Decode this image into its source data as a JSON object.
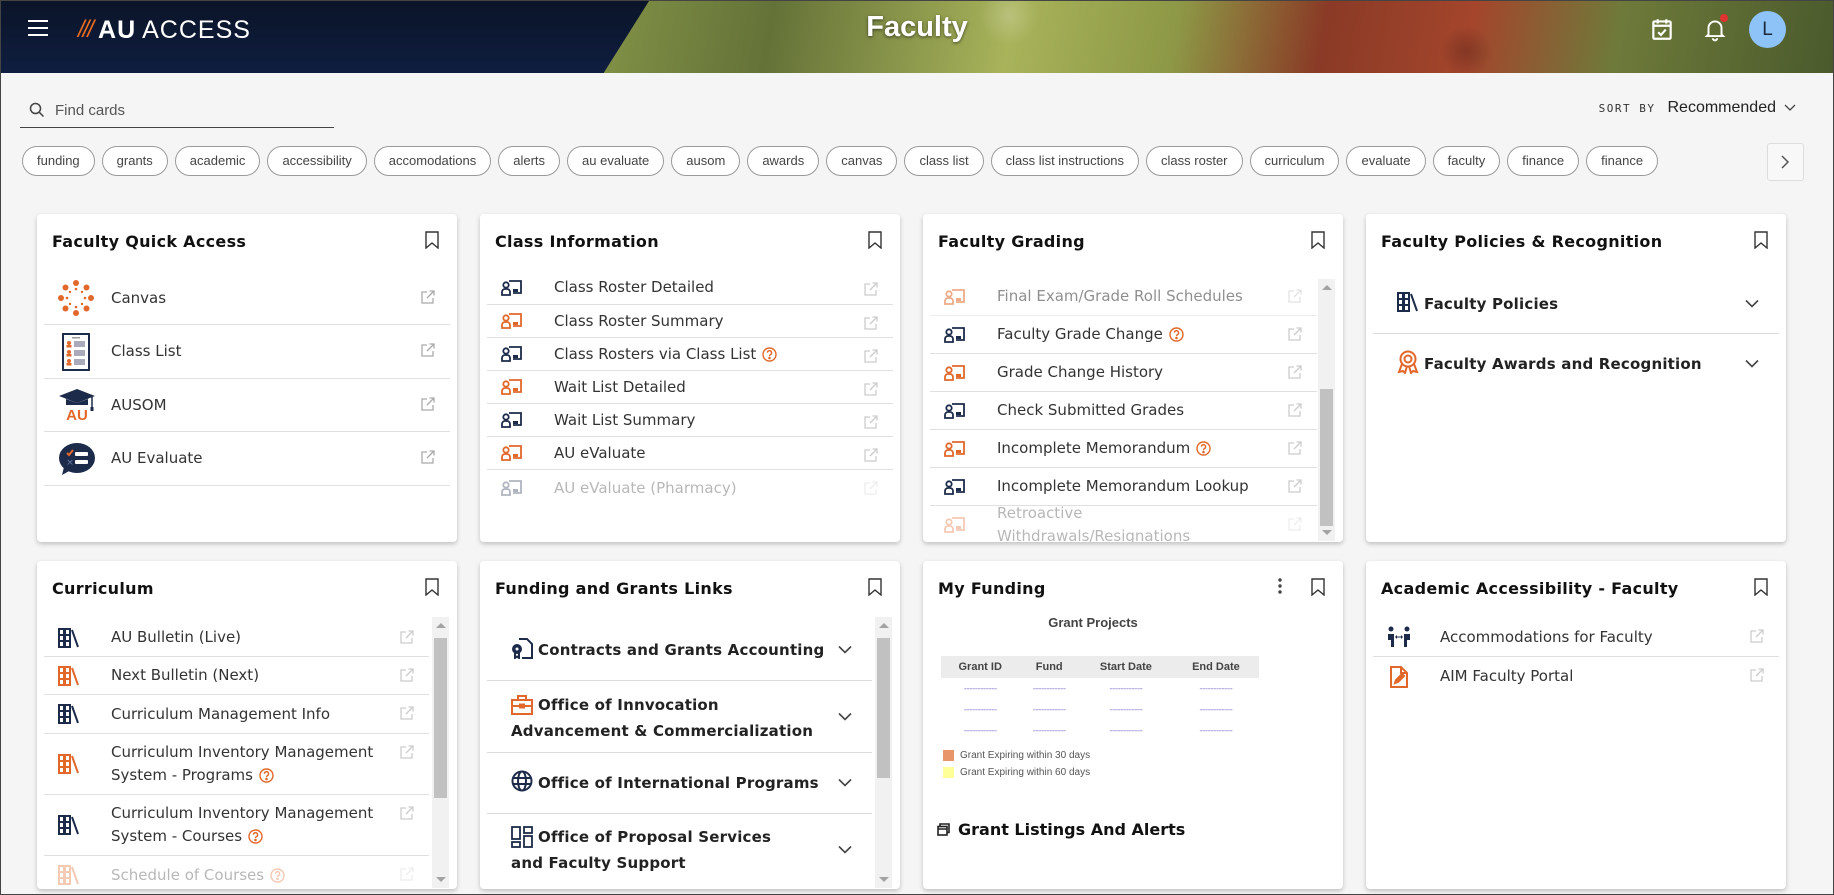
{
  "header": {
    "logo_slashes": "///",
    "logo_au": "AU",
    "logo_access": "ACCESS",
    "page_title": "Faculty",
    "avatar_initial": "L",
    "colors": {
      "navy": "#0f1e40",
      "orange": "#e86b1f",
      "avatar": "#8ec3f7",
      "notification_dot": "#e0322f"
    }
  },
  "search": {
    "placeholder": "Find cards",
    "value": ""
  },
  "sort": {
    "label": "SORT BY",
    "value": "Recommended"
  },
  "chips": [
    "funding",
    "grants",
    "academic",
    "accessibility",
    "accomodations",
    "alerts",
    "au evaluate",
    "ausom",
    "awards",
    "canvas",
    "class list",
    "class list instructions",
    "class roster",
    "curriculum",
    "evaluate",
    "faculty",
    "finance",
    "finance"
  ],
  "cards": {
    "quick_access": {
      "title": "Faculty Quick Access",
      "items": [
        {
          "label": "Canvas",
          "icon": "canvas-logo-icon"
        },
        {
          "label": "Class List",
          "icon": "class-list-icon"
        },
        {
          "label": "AUSOM",
          "icon": "ausom-graduation-cap-icon"
        },
        {
          "label": "AU Evaluate",
          "icon": "au-evaluate-chat-icon"
        }
      ]
    },
    "class_info": {
      "title": "Class Information",
      "items": [
        {
          "label": "Class Roster Detailed",
          "color": "navy",
          "help": false
        },
        {
          "label": "Class Roster Summary",
          "color": "orange",
          "help": false
        },
        {
          "label": "Class Rosters via Class List",
          "color": "navy",
          "help": true
        },
        {
          "label": "Wait List Detailed",
          "color": "orange",
          "help": false
        },
        {
          "label": "Wait List Summary",
          "color": "navy",
          "help": false
        },
        {
          "label": "AU eValuate",
          "color": "orange",
          "help": false
        },
        {
          "label": "AU eValuate (Pharmacy)",
          "color": "navy",
          "help": false
        }
      ]
    },
    "grading": {
      "title": "Faculty Grading",
      "items": [
        {
          "label": "Final Exam/Grade Roll Schedules",
          "color": "orange",
          "help": false
        },
        {
          "label": "Faculty Grade Change",
          "color": "navy",
          "help": true
        },
        {
          "label": "Grade Change History",
          "color": "orange",
          "help": false
        },
        {
          "label": "Check Submitted Grades",
          "color": "navy",
          "help": false
        },
        {
          "label": "Incomplete Memorandum",
          "color": "orange",
          "help": true
        },
        {
          "label": "Incomplete Memorandum Lookup",
          "color": "navy",
          "help": false
        },
        {
          "label": "Retroactive Withdrawals/Resignations",
          "color": "orange",
          "help": false
        }
      ]
    },
    "policies": {
      "title": "Faculty Policies & Recognition",
      "items": [
        {
          "label": "Faculty Policies",
          "icon": "books-icon"
        },
        {
          "label": "Faculty Awards and Recognition",
          "icon": "award-ribbon-icon"
        }
      ]
    },
    "curriculum": {
      "title": "Curriculum",
      "items": [
        {
          "label": "AU Bulletin (Live)",
          "color": "navy",
          "help": false
        },
        {
          "label": "Next Bulletin (Next)",
          "color": "orange",
          "help": false
        },
        {
          "label": "Curriculum Management Info",
          "color": "navy",
          "help": false
        },
        {
          "label": "Curriculum Inventory Management System - Programs",
          "color": "orange",
          "help": true
        },
        {
          "label": "Curriculum Inventory Management System - Courses",
          "color": "navy",
          "help": true
        },
        {
          "label": "Schedule of Courses",
          "color": "orange",
          "help": true
        }
      ]
    },
    "funding_links": {
      "title": "Funding and Grants Links",
      "items": [
        {
          "label": "Contracts and Grants Accounting",
          "icon": "certificate-document-icon"
        },
        {
          "label": "Office of Innvocation Advancement & Commercialization",
          "icon": "briefcase-icon"
        },
        {
          "label": "Office of International Programs",
          "icon": "globe-icon"
        },
        {
          "label": "Office of Proposal Services and Faculty Support",
          "icon": "dashboard-grid-icon"
        }
      ]
    },
    "my_funding": {
      "title": "My Funding",
      "table_title": "Grant Projects",
      "columns": [
        "Grant ID",
        "Fund",
        "Start Date",
        "End Date"
      ],
      "placeholder_rows": [
        [
          "------------",
          "------------",
          "------------",
          "------------"
        ],
        [
          "------------",
          "------------",
          "------------",
          "------------"
        ],
        [
          "------------",
          "------------",
          "------------",
          "------------"
        ]
      ],
      "legend": [
        {
          "label": "Grant Expiring within 30 days",
          "color": "#e8956a"
        },
        {
          "label": "Grant Expiring within 60 days",
          "color": "#ffff99"
        }
      ],
      "listings_label": "Grant Listings And Alerts"
    },
    "accessibility": {
      "title": "Academic Accessibility - Faculty",
      "items": [
        {
          "label": "Accommodations for Faculty",
          "icon": "accommodation-people-icon"
        },
        {
          "label": "AIM Faculty Portal",
          "icon": "document-edit-icon"
        }
      ]
    }
  }
}
